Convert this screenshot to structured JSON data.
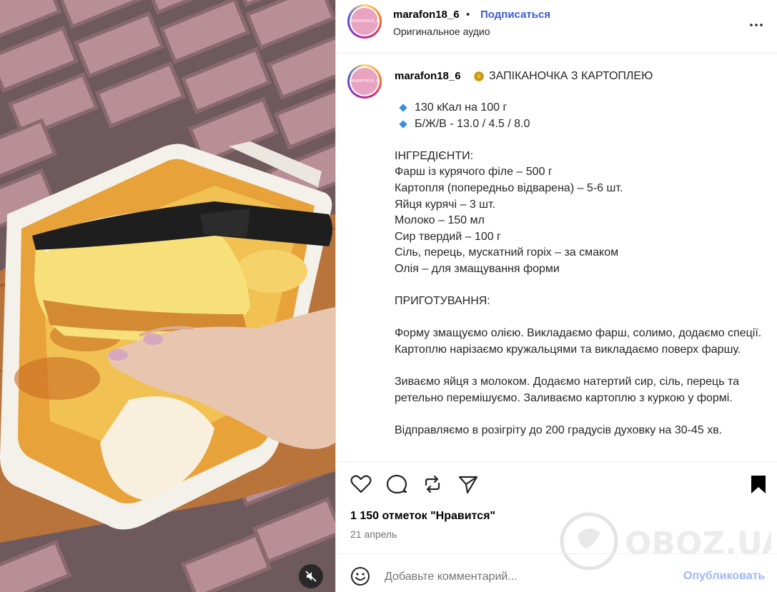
{
  "post": {
    "username": "marafon18_6",
    "avatar_text": "MARAFON18_6",
    "follow_label": "Подписаться",
    "separator": "•",
    "audio_label": "Оригинальное аудио",
    "more_icon": "more-horizontal-icon"
  },
  "caption": {
    "username": "marafon18_6",
    "title": "ЗАПІКАНОЧКА З КАРТОПЛЕЮ",
    "bullets": [
      "130 кКал на 100 г",
      "Б/Ж/В - 13.0 / 4.5 / 8.0"
    ],
    "ingredients_header": "ІНГРЕДІЄНТИ:",
    "ingredients": [
      "Фарш із курячого філе – 500 г",
      "Картопля (попередньо відварена) – 5-6 шт.",
      "Яйця курячі – 3 шт.",
      "Молоко – 150 мл",
      "Сир твердий – 100 г",
      "Сіль, перець, мускатний горіх – за смаком",
      "Олія – для змащування форми"
    ],
    "prep_header": "ПРИГОТУВАННЯ:",
    "steps": [
      "Форму змащуємо олією. Викладаємо фарш, солимо, додаємо спеції. Картоплю нарізаємо кружальцями та викладаємо поверх фаршу.",
      "Зиваємо яйця з молоком. Додаємо натертий сир, сіль, перець та ретельно перемішуємо. Заливаємо картоплю з куркою у формі.",
      "Відправляємо в розігріту до 200 градусів духовку на 30-45 хв."
    ]
  },
  "actions": {
    "icons": [
      "heart-icon",
      "comment-icon",
      "repost-icon",
      "share-icon",
      "bookmark-icon"
    ],
    "likes": "1 150 отметок \"Нравится\"",
    "date": "21 апрель"
  },
  "comment": {
    "placeholder": "Добавьте комментарий...",
    "publish_label": "Опубликовать"
  },
  "watermark": {
    "text": "OBOZ.UA"
  },
  "colors": {
    "accent_blue": "#3b5bd9",
    "publish_disabled": "#9fb8f5",
    "bullet_blue": "#3a8ee6"
  }
}
